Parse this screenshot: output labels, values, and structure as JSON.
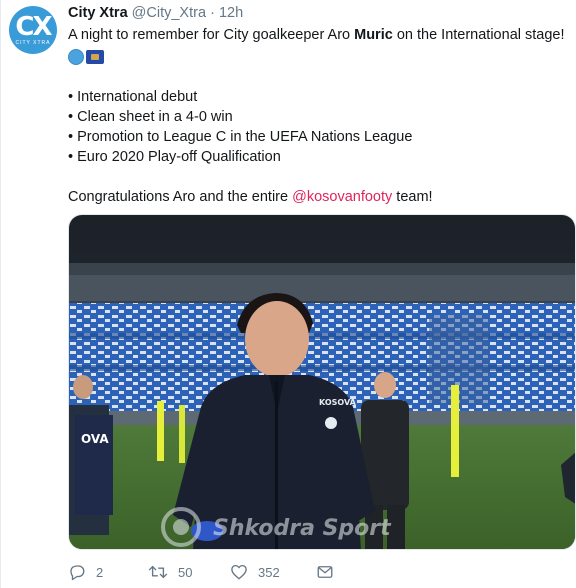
{
  "colors": {
    "accent": "#1da1f2",
    "mention": "#e0245e",
    "muted": "#657786",
    "text": "#14171a",
    "avatar_bg": "#3a9bd9"
  },
  "avatar": {
    "glyph": "CX",
    "sub": "CITY XTRA",
    "icon": "city-xtra-logo"
  },
  "header": {
    "name": "City Xtra",
    "handle": "@City_Xtra",
    "separator": "·",
    "time": "12h"
  },
  "tweet": {
    "line1_pre": "A night to remember for City goalkeeper Aro ",
    "line1_bold": "Muric",
    "line1_post": " on the International stage!",
    "emojis": [
      "blue-circle-emoji",
      "kosovo-flag-emoji"
    ],
    "bullets": [
      "• International debut",
      "• Clean sheet in a 4-0 win",
      "• Promotion to League C in the UEFA Nations League",
      "• Euro 2020 Play-off Qualification"
    ],
    "closing_pre": "Congratulations Aro and the entire ",
    "closing_mention": "@kosovanfooty",
    "closing_post": " team!"
  },
  "photo": {
    "watermark": "Shkodra Sport",
    "jersey_text": "KOSOVA",
    "jersey_text_partial": "OVA"
  },
  "actions": {
    "replies": "2",
    "retweets": "50",
    "likes": "352"
  }
}
